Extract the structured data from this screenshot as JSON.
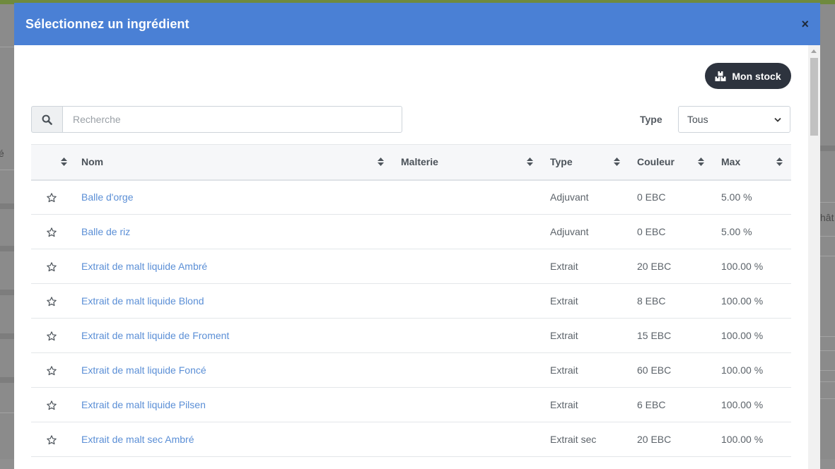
{
  "background": {
    "edge_left_text": "é",
    "edge_right_text": "hât"
  },
  "modal": {
    "title": "Sélectionnez un ingrédient",
    "close_label": "×"
  },
  "toolbar": {
    "stock_label": "Mon stock",
    "stock_icon": "boxes-icon"
  },
  "search": {
    "placeholder": "Recherche",
    "value": "",
    "icon": "search-icon"
  },
  "filter": {
    "type_label": "Type",
    "type_value": "Tous"
  },
  "table": {
    "columns": [
      "",
      "Nom",
      "Malterie",
      "Type",
      "Couleur",
      "Max"
    ],
    "rows": [
      {
        "name": "Balle d'orge",
        "malterie": "",
        "type": "Adjuvant",
        "color": "0 EBC",
        "max": "5.00 %"
      },
      {
        "name": "Balle de riz",
        "malterie": "",
        "type": "Adjuvant",
        "color": "0 EBC",
        "max": "5.00 %"
      },
      {
        "name": "Extrait de malt liquide Ambré",
        "malterie": "",
        "type": "Extrait",
        "color": "20 EBC",
        "max": "100.00 %"
      },
      {
        "name": "Extrait de malt liquide Blond",
        "malterie": "",
        "type": "Extrait",
        "color": "8 EBC",
        "max": "100.00 %"
      },
      {
        "name": "Extrait de malt liquide de Froment",
        "malterie": "",
        "type": "Extrait",
        "color": "15 EBC",
        "max": "100.00 %"
      },
      {
        "name": "Extrait de malt liquide Foncé",
        "malterie": "",
        "type": "Extrait",
        "color": "60 EBC",
        "max": "100.00 %"
      },
      {
        "name": "Extrait de malt liquide Pilsen",
        "malterie": "",
        "type": "Extrait",
        "color": "6 EBC",
        "max": "100.00 %"
      },
      {
        "name": "Extrait de malt sec Ambré",
        "malterie": "",
        "type": "Extrait sec",
        "color": "20 EBC",
        "max": "100.00 %"
      }
    ]
  },
  "colors": {
    "header_bg": "#4a80d5",
    "link": "#5b8fd6",
    "stock_button_bg": "#2d333e"
  }
}
